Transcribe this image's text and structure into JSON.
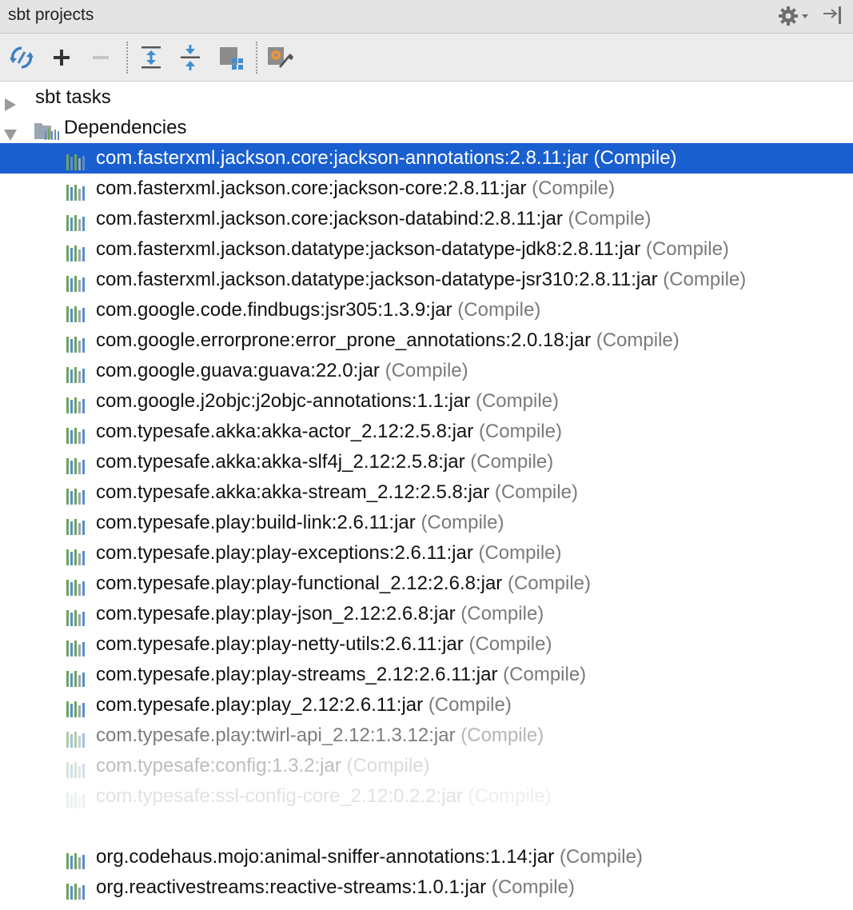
{
  "panel": {
    "title": "sbt projects",
    "settings_icon": "gear-icon",
    "hide_icon": "pin-right-icon"
  },
  "toolbar": {
    "buttons": [
      {
        "name": "refresh-button",
        "icon": "refresh-icon"
      },
      {
        "name": "add-button",
        "icon": "plus-icon"
      },
      {
        "name": "remove-button",
        "icon": "minus-icon"
      },
      {
        "name": "expand-all-button",
        "icon": "expand-all-icon"
      },
      {
        "name": "collapse-all-button",
        "icon": "collapse-all-icon"
      },
      {
        "name": "group-modules-button",
        "icon": "group-icon"
      },
      {
        "name": "build-settings-button",
        "icon": "settings-wrench-icon"
      }
    ]
  },
  "tree": {
    "sbt_tasks": "sbt tasks",
    "dependencies": "Dependencies",
    "scope": "(Compile)",
    "deps": [
      "com.fasterxml.jackson.core:jackson-annotations:2.8.11:jar",
      "com.fasterxml.jackson.core:jackson-core:2.8.11:jar",
      "com.fasterxml.jackson.core:jackson-databind:2.8.11:jar",
      "com.fasterxml.jackson.datatype:jackson-datatype-jdk8:2.8.11:jar",
      "com.fasterxml.jackson.datatype:jackson-datatype-jsr310:2.8.11:jar",
      "com.google.code.findbugs:jsr305:1.3.9:jar",
      "com.google.errorprone:error_prone_annotations:2.0.18:jar",
      "com.google.guava:guava:22.0:jar",
      "com.google.j2objc:j2objc-annotations:1.1:jar",
      "com.typesafe.akka:akka-actor_2.12:2.5.8:jar",
      "com.typesafe.akka:akka-slf4j_2.12:2.5.8:jar",
      "com.typesafe.akka:akka-stream_2.12:2.5.8:jar",
      "com.typesafe.play:build-link:2.6.11:jar",
      "com.typesafe.play:play-exceptions:2.6.11:jar",
      "com.typesafe.play:play-functional_2.12:2.6.8:jar",
      "com.typesafe.play:play-json_2.12:2.6.8:jar",
      "com.typesafe.play:play-netty-utils:2.6.11:jar",
      "com.typesafe.play:play-streams_2.12:2.6.11:jar",
      "com.typesafe.play:play_2.12:2.6.11:jar",
      "com.typesafe.play:twirl-api_2.12:1.3.12:jar",
      "com.typesafe:config:1.3.2:jar",
      "com.typesafe:ssl-config-core_2.12:0.2.2:jar",
      "org.codehaus.mojo:animal-sniffer-annotations:1.14:jar",
      "org.reactivestreams:reactive-streams:1.0.1:jar"
    ]
  }
}
